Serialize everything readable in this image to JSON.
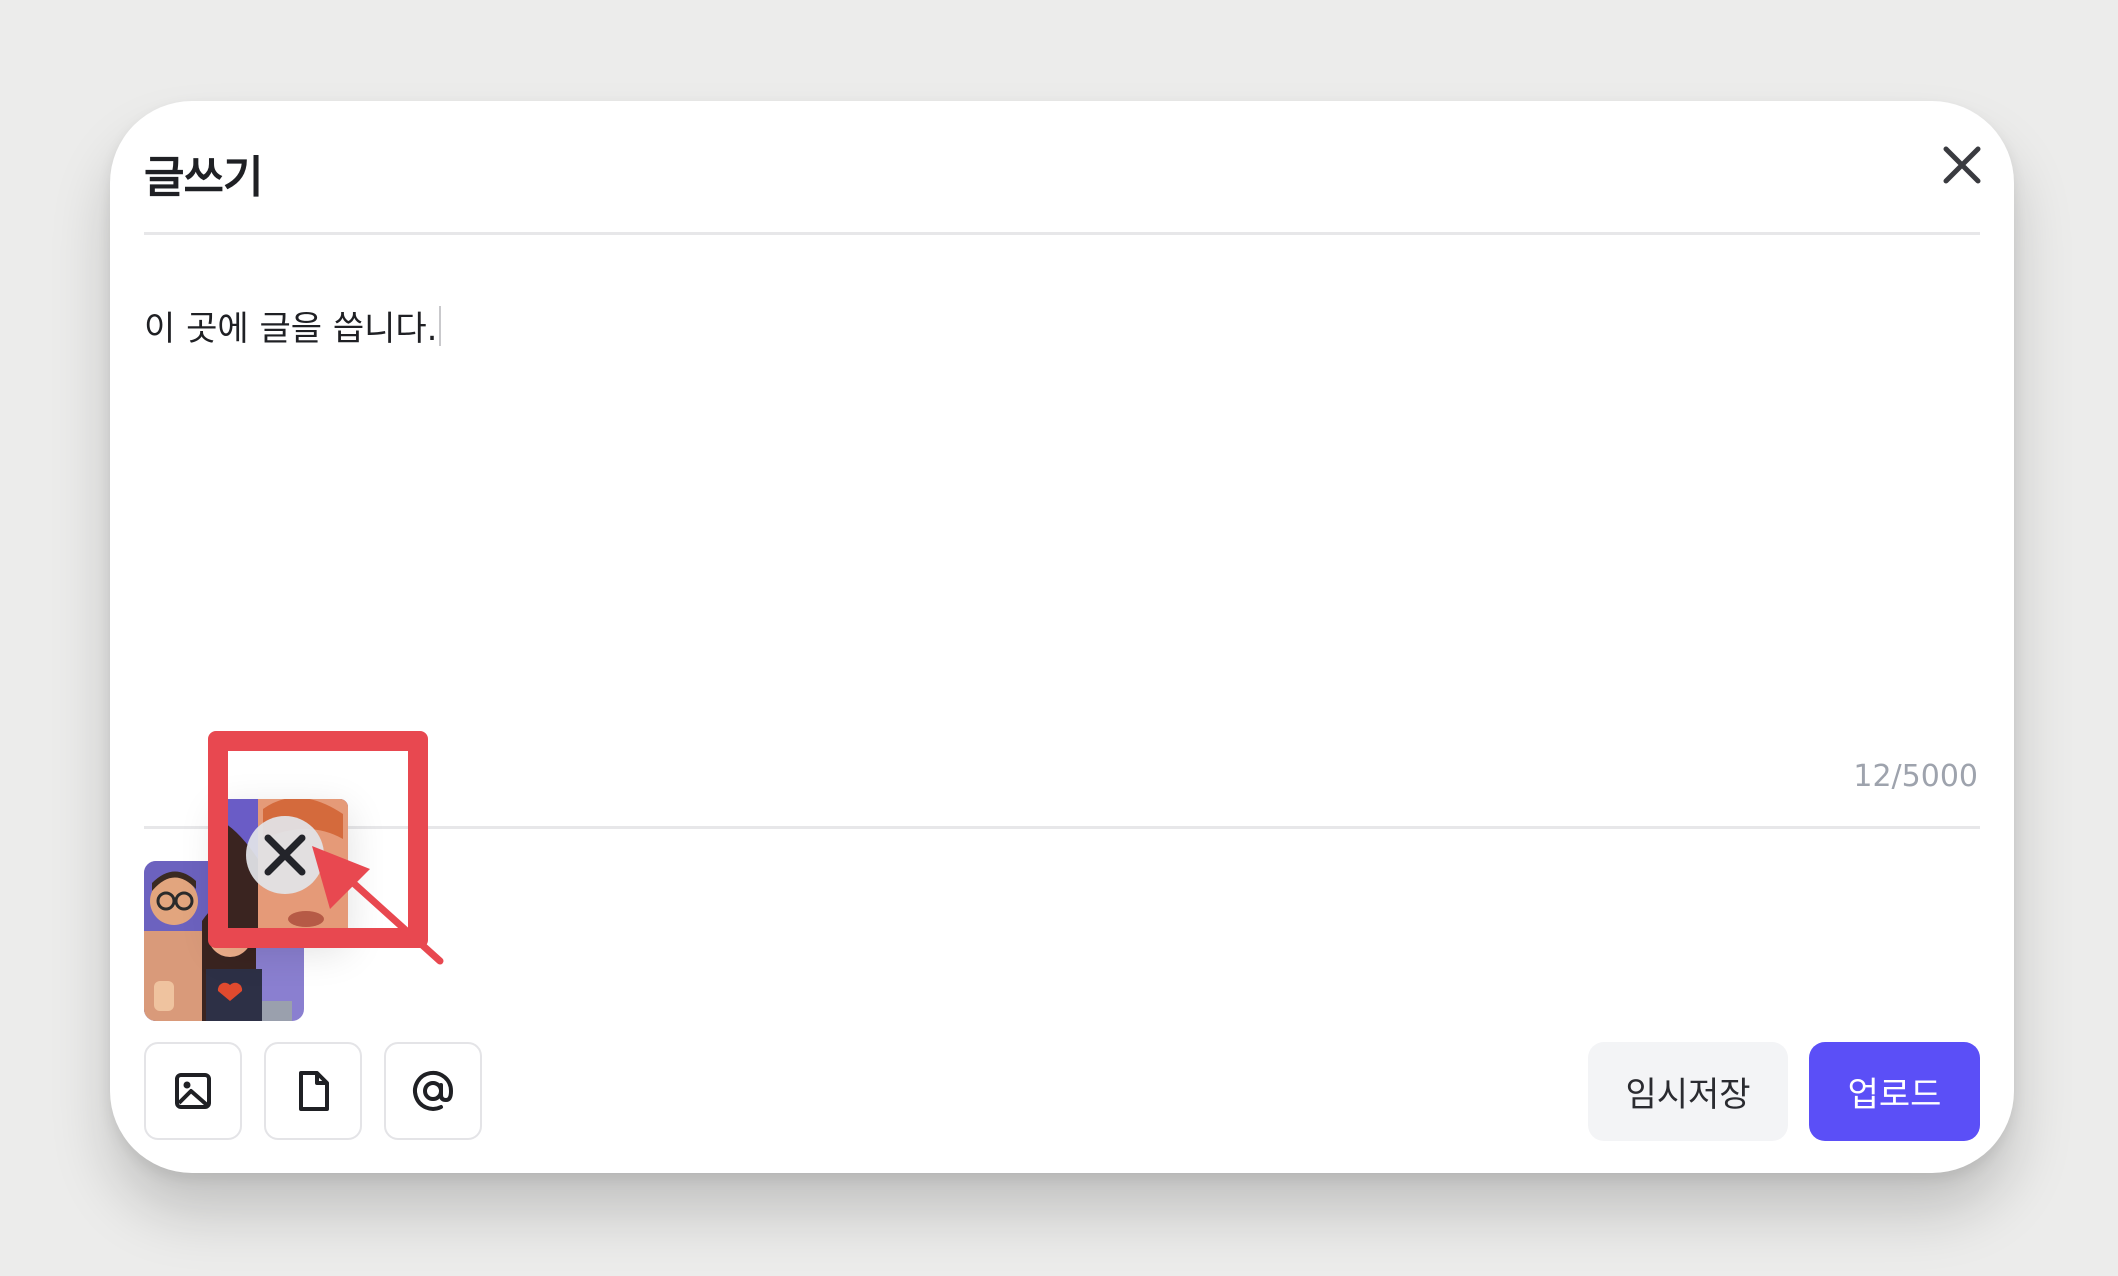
{
  "dialog": {
    "title": "글쓰기",
    "close_icon": "close-icon"
  },
  "editor": {
    "content": "이 곳에 글을 씁니다.",
    "counter": "12/5000"
  },
  "attachments": {
    "images": [
      "thumbnail-people-illustration",
      "thumbnail-dragging-illustration"
    ],
    "remove_icon": "close-icon"
  },
  "toolbar": {
    "icons": [
      "image-icon",
      "file-icon",
      "at-icon"
    ],
    "draft_label": "임시저장",
    "upload_label": "업로드"
  },
  "colors": {
    "primary": "#5b4ff7",
    "highlight": "#e84850",
    "counter": "#9ea3ad"
  }
}
